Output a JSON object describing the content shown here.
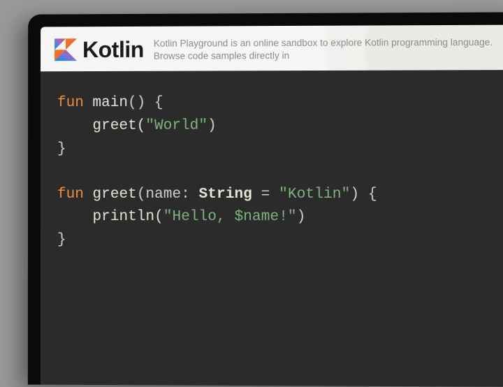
{
  "header": {
    "product_name": "Kotlin",
    "tagline": "Kotlin Playground is an online sandbox to explore Kotlin programming language. Browse code samples directly in"
  },
  "code": {
    "line1_kw": "fun",
    "line1_fn": " main",
    "line1_rest": "() {",
    "line2_indent": "    ",
    "line2_call": "greet(",
    "line2_str": "\"World\"",
    "line2_close": ")",
    "line3": "}",
    "blank": "",
    "line4_kw": "fun",
    "line4_fn": " greet",
    "line4_open": "(",
    "line4_param": "name: ",
    "line4_type": "String",
    "line4_eq": " = ",
    "line4_default": "\"Kotlin\"",
    "line4_close": ") {",
    "line5_indent": "    ",
    "line5_call": "println(",
    "line5_str": "\"Hello, $name!\"",
    "line5_close": ")",
    "line6": "}"
  }
}
